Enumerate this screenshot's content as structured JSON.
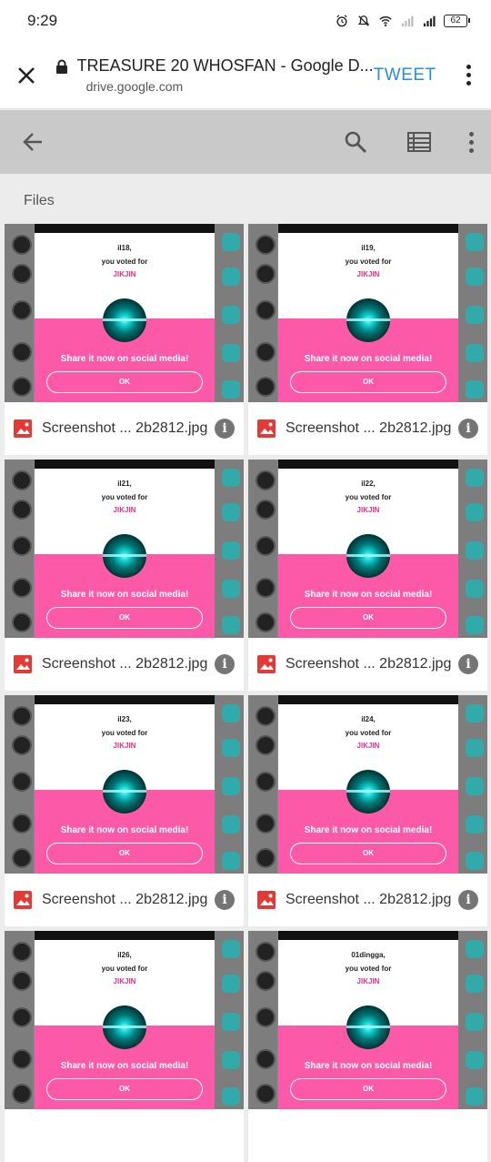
{
  "status_bar": {
    "time": "9:29",
    "battery": "62"
  },
  "browser": {
    "title": "TREASURE 20 WHOSFAN - Google D...",
    "host": "drive.google.com",
    "tweet_label": "TWEET"
  },
  "drive": {
    "section_label": "Files"
  },
  "dialog_common": {
    "voted_text": "you voted for",
    "candidate": "JIKJIN",
    "share_text": "Share it now on social media!",
    "ok_label": "OK"
  },
  "files": [
    {
      "voter": "il18,",
      "name": "Screenshot ... 2b2812.jpg"
    },
    {
      "voter": "il19,",
      "name": "Screenshot ... 2b2812.jpg"
    },
    {
      "voter": "il21,",
      "name": "Screenshot ... 2b2812.jpg"
    },
    {
      "voter": "il22,",
      "name": "Screenshot ... 2b2812.jpg"
    },
    {
      "voter": "il23,",
      "name": "Screenshot ... 2b2812.jpg"
    },
    {
      "voter": "il24,",
      "name": "Screenshot ... 2b2812.jpg"
    },
    {
      "voter": "il26,",
      "name": ""
    },
    {
      "voter": "01dingga,",
      "name": ""
    }
  ]
}
